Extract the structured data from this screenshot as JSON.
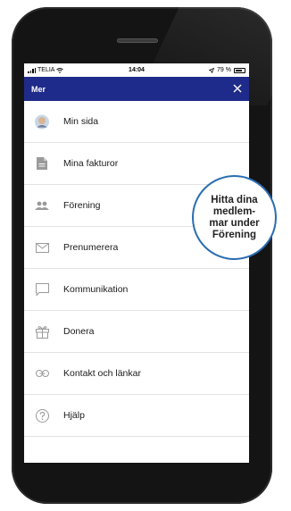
{
  "status_bar": {
    "carrier": "TELIA",
    "time": "14:04",
    "battery": "79 %",
    "battery_level": 0.79
  },
  "nav": {
    "title": "Mer",
    "close_icon": "close-icon"
  },
  "menu": {
    "items": [
      {
        "label": "Min sida",
        "icon": "avatar"
      },
      {
        "label": "Mina fakturor",
        "icon": "document-icon"
      },
      {
        "label": "Förening",
        "icon": "people-icon"
      },
      {
        "label": "Prenumerera",
        "icon": "envelope-icon"
      },
      {
        "label": "Kommunikation",
        "icon": "chat-icon"
      },
      {
        "label": "Donera",
        "icon": "gift-icon"
      },
      {
        "label": "Kontakt och länkar",
        "icon": "link-icon"
      },
      {
        "label": "Hjälp",
        "icon": "help-icon"
      }
    ]
  },
  "callout": {
    "lines": [
      "Hitta dina",
      "medlem-",
      "mar under",
      "Förening"
    ]
  },
  "colors": {
    "nav_background": "#1f2b8a",
    "callout_border": "#2a6db2",
    "icon_gray": "#9a9a9a"
  }
}
